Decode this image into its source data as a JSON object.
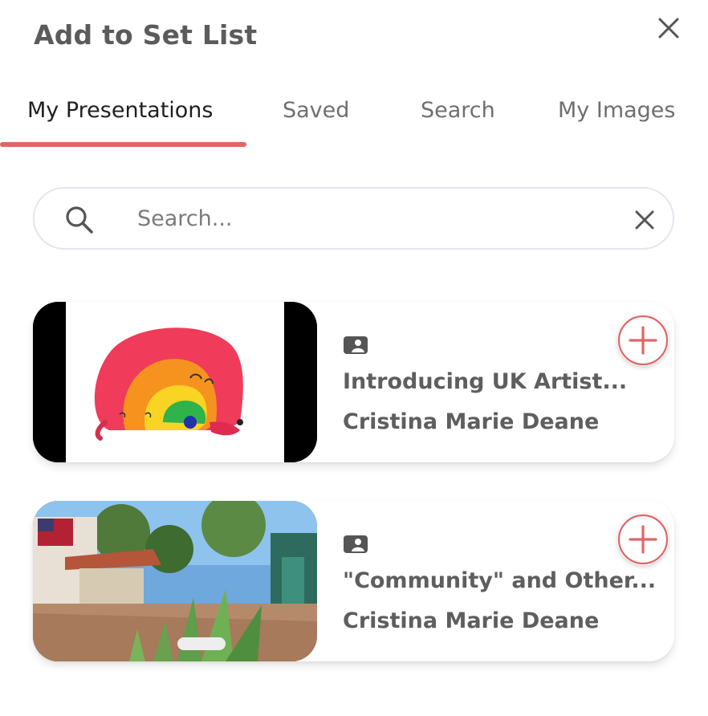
{
  "dialog": {
    "title": "Add to Set List",
    "close_icon": "close-icon"
  },
  "tabs": [
    {
      "label": "My Presentations",
      "active": true
    },
    {
      "label": "Saved",
      "active": false
    },
    {
      "label": "Search",
      "active": false
    },
    {
      "label": "My Images",
      "active": false
    }
  ],
  "search": {
    "placeholder": "Search...",
    "value": "",
    "icon": "search-icon",
    "clear_icon": "clear-icon"
  },
  "presentations": [
    {
      "title": "Introducing UK Artist...",
      "author": "Cristina Marie Deane",
      "type_icon": "presentation-icon",
      "add_icon": "plus-icon"
    },
    {
      "title": "\"Community\" and Other...",
      "author": "Cristina Marie Deane",
      "type_icon": "presentation-icon",
      "add_icon": "plus-icon"
    }
  ],
  "colors": {
    "accent": "#e06666",
    "tab_active_text": "#1f1f1f",
    "tab_inactive_text": "#6f6f6f",
    "card_text": "#5e5e5e",
    "title_text": "#5b5b5b"
  }
}
